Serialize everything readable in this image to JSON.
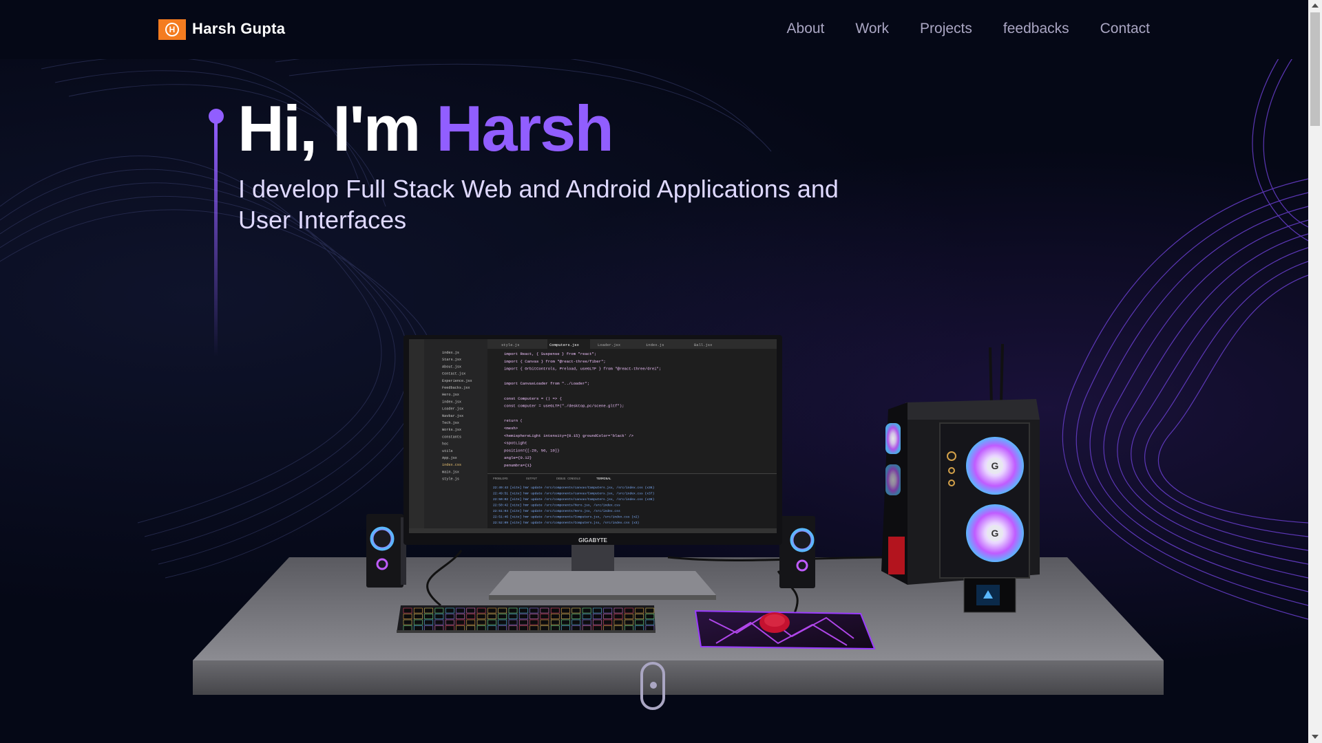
{
  "nav": {
    "brand": "Harsh  Gupta",
    "logo_letter": "H",
    "logo_icon": "logo-icon",
    "links": [
      "About",
      "Work",
      "Projects",
      "feedbacks",
      "Contact"
    ]
  },
  "hero": {
    "greeting": "Hi, I'm ",
    "name": "Harsh",
    "subtitle": "I develop Full Stack Web and Android Applications and User Interfaces"
  },
  "monitor": {
    "brand": "GIGABYTE",
    "tabs": [
      "style.js",
      "Computers.jsx",
      "Loader.jsx",
      "index.js",
      "Ball.jsx"
    ],
    "files": [
      "index.js",
      "Stars.jsx",
      "About.jsx",
      "Contact.jsx",
      "Experience.jsx",
      "Feedbacks.jsx",
      "Hero.jsx",
      "index.jsx",
      "Loader.jsx",
      "Navbar.jsx",
      "Tech.jsx",
      "Works.jsx",
      "constants",
      "hoc",
      "utils",
      "App.jsx",
      "index.css",
      "main.jsx",
      "style.js"
    ],
    "code_lines": [
      "import React, { Suspense } from \"react\";",
      "import { Canvas } from \"@react-three/fiber\";",
      "import { OrbitControls, Preload, useGLTF } from \"@react-three/drei\";",
      "",
      "import CanvasLoader from \"../Loader\";",
      "",
      "const Computers = () => {",
      "  const computer = useGLTF(\"./desktop_pc/scene.gltf\");",
      "",
      "  return (",
      "    <mesh>",
      "      <hemisphereLight intensity={0.15} groundColor='black' />",
      "      <spotLight",
      "        position={[-20, 50, 10]}",
      "        angle={0.12}",
      "        penumbra={1}"
    ],
    "terminal_tabs": [
      "PROBLEMS",
      "OUTPUT",
      "DEBUG CONSOLE",
      "TERMINAL"
    ],
    "terminal_lines": [
      "22:49:43 [vite] hmr update /src/components/canvas/Computers.jsx, /src/index.css (x36)",
      "22:49:51 [vite] hmr update /src/components/canvas/Computers.jsx, /src/index.css (x37)",
      "22:50:02 [vite] hmr update /src/components/canvas/Computers.jsx, /src/index.css (x38)",
      "22:50:42 [vite] hmr update /src/components/Hero.jsx, /src/index.css",
      "22:51:04 [vite] hmr update /src/components/Hero.jsx, /src/index.css",
      "22:51:46 [vite] hmr update /src/components/Computers.jsx, /src/index.css (x2)",
      "22:52:09 [vite] hmr update /src/components/Computers.jsx, /src/index.css (x3)"
    ]
  },
  "colors": {
    "background": "#050816",
    "accent": "#915eff",
    "logo_bg": "#f47c20",
    "nav_text": "#aaa6c3"
  }
}
